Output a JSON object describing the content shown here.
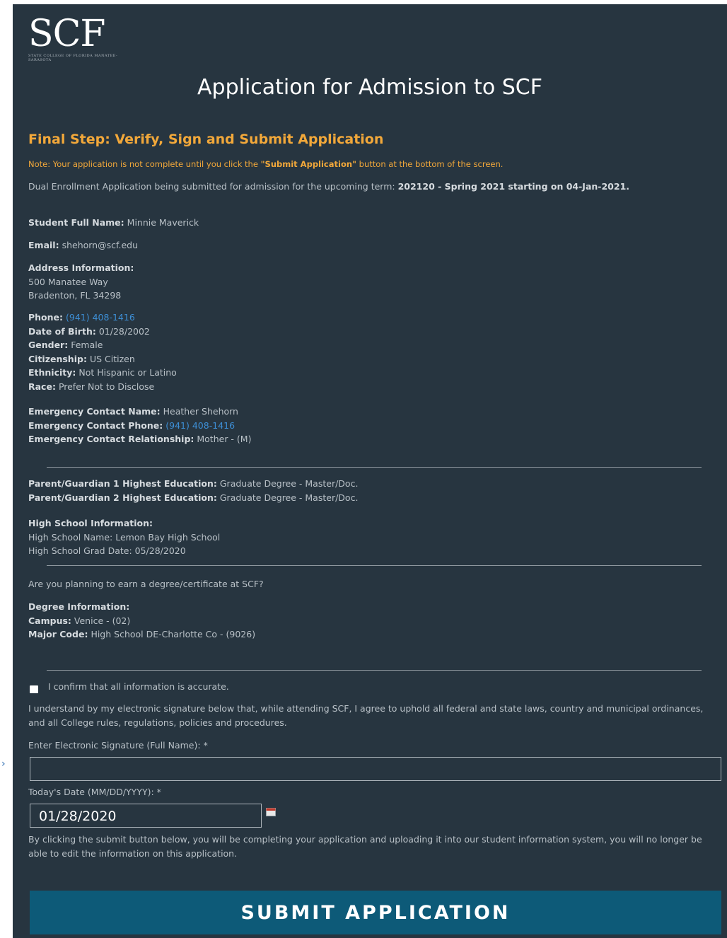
{
  "logo": {
    "mark": "SCF",
    "subtitle": "STATE COLLEGE OF FLORIDA MANATEE-SARASOTA"
  },
  "page_title": "Application for Admission to SCF",
  "step_heading": "Final Step: Verify, Sign and Submit Application",
  "note": {
    "prefix": "Note: Your application is not complete until you click the ",
    "emphasis": "\"Submit Application\"",
    "suffix": " button at the bottom of the screen."
  },
  "intro": {
    "text": "Dual Enrollment Application being submitted for admission for the upcoming term: ",
    "term": "202120 - Spring 2021 starting on 04-Jan-2021."
  },
  "student": {
    "name_label": "Student Full Name:",
    "name": "Minnie Maverick",
    "email_label": "Email:",
    "email": "shehorn@scf.edu",
    "address_label": "Address Information:",
    "address_line1": "500 Manatee Way",
    "address_line2": "Bradenton, FL 34298",
    "phone_label": "Phone:",
    "phone": "(941) 408-1416",
    "dob_label": "Date of Birth:",
    "dob": "01/28/2002",
    "gender_label": "Gender:",
    "gender": "Female",
    "citizenship_label": "Citizenship:",
    "citizenship": "US Citizen",
    "ethnicity_label": "Ethnicity:",
    "ethnicity": "Not Hispanic or Latino",
    "race_label": "Race:",
    "race": "Prefer Not to Disclose"
  },
  "emergency": {
    "name_label": "Emergency Contact Name:",
    "name": "Heather Shehorn",
    "phone_label": "Emergency Contact Phone:",
    "phone": "(941) 408-1416",
    "relationship_label": "Emergency Contact Relationship:",
    "relationship": "Mother - (M)"
  },
  "parents": {
    "p1_label": "Parent/Guardian 1 Highest Education:",
    "p1": "Graduate Degree - Master/Doc.",
    "p2_label": "Parent/Guardian 2 Highest Education:",
    "p2": "Graduate Degree - Master/Doc."
  },
  "high_school": {
    "heading": "High School Information:",
    "name_label": "High School Name:",
    "name": "Lemon Bay High School",
    "grad_label": "High School Grad Date:",
    "grad": "05/28/2020"
  },
  "degree_question": "Are you planning to earn a degree/certificate at SCF?",
  "degree": {
    "heading": "Degree Information:",
    "campus_label": "Campus:",
    "campus": "Venice - (02)",
    "major_label": "Major Code:",
    "major": "High School DE-Charlotte Co - (9026)"
  },
  "confirm_label": "I confirm that all information is accurate.",
  "agreement": "I understand by my electronic signature below that, while attending SCF, I agree to uphold all federal and state laws, country and municipal ordinances, and all College rules, regulations, policies and procedures.",
  "signature": {
    "label": "Enter Electronic Signature (Full Name):",
    "required": "*",
    "value": ""
  },
  "date": {
    "label": "Today's Date (MM/DD/YYYY):",
    "required": "*",
    "value": "01/28/2020"
  },
  "final_note": "By clicking the submit button below, you will be completing your application and uploading it into our student information system, you will no longer be able to edit the information on this application.",
  "submit_label": "SUBMIT APPLICATION",
  "colors": {
    "panel": "#273540",
    "accent_orange": "#f2a83a",
    "link_blue": "#3d8fd6",
    "button": "#0d5a78"
  }
}
